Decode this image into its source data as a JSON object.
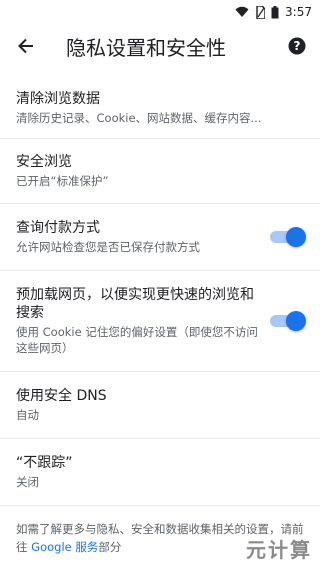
{
  "status": {
    "time": "3:57"
  },
  "appbar": {
    "title": "隐私设置和安全性"
  },
  "items": [
    {
      "title": "清除浏览数据",
      "sub": "清除历史记录、Cookie、网站数据、缓存内容..."
    },
    {
      "title": "安全浏览",
      "sub": "已开启“标准保护”"
    },
    {
      "title": "查询付款方式",
      "sub": "允许网站检查您是否已保存付款方式",
      "toggle": true
    },
    {
      "title": "预加载网页，以便实现更快速的浏览和搜索",
      "sub": "使用 Cookie 记住您的偏好设置（即使您不访问这些网页）",
      "toggle": true
    },
    {
      "title": "使用安全 DNS",
      "sub": "自动"
    },
    {
      "title": "“不跟踪”",
      "sub": "关闭"
    }
  ],
  "footer": {
    "text_before": "如需了解更多与隐私、安全和数据收集相关的设置，请前往 ",
    "link": "Google 服务",
    "text_after": "部分"
  },
  "watermark": "元计算",
  "colors": {
    "accent": "#1a73e8",
    "toggle_track": "#a8c7fa"
  }
}
